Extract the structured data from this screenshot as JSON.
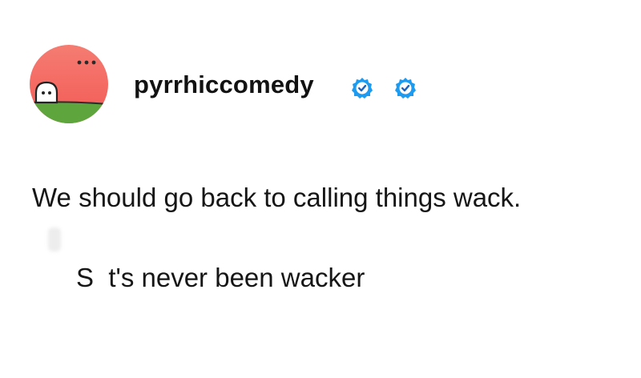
{
  "post": {
    "username": "pyrrhiccomedy",
    "text_line_1": "We should go back to calling things wack.",
    "text_line_2": "S  t's never been wacker"
  },
  "icons": {
    "avatar": "ghost-on-hill-avatar-icon",
    "badge_1": "verified-checkmark-icon",
    "badge_2": "verified-checkmark-icon"
  },
  "colors": {
    "avatar_sky": "#f46a63",
    "avatar_grass": "#5ea53e",
    "badge_blue": "#1d9bf0",
    "badge_ring": "#3a8edb",
    "text": "#161616"
  }
}
